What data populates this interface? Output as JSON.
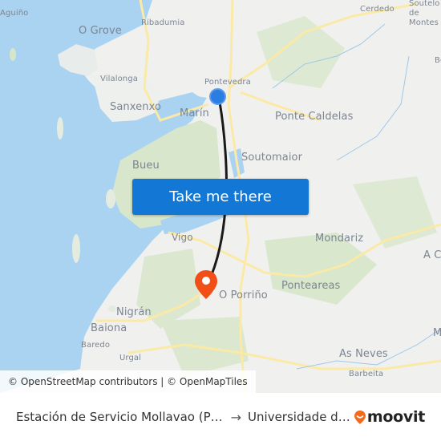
{
  "map": {
    "places": [
      {
        "name": "Aguiño",
        "size": "sm"
      },
      {
        "name": "O Grove",
        "size": "lg"
      },
      {
        "name": "Ribadumia",
        "size": "sm"
      },
      {
        "name": "Cerdedo",
        "size": "sm"
      },
      {
        "name": "Soutelo de Montes",
        "size": "sm"
      },
      {
        "name": "Pontevedra",
        "size": "sm"
      },
      {
        "name": "Vilalonga",
        "size": "sm"
      },
      {
        "name": "Sanxenxo",
        "size": "lg"
      },
      {
        "name": "Marín",
        "size": "lg"
      },
      {
        "name": "Ponte Caldelas",
        "size": "lg"
      },
      {
        "name": "Soutomaior",
        "size": "lg"
      },
      {
        "name": "Bueu",
        "size": "lg"
      },
      {
        "name": "Vigo",
        "size": "md"
      },
      {
        "name": "Mondariz",
        "size": "lg"
      },
      {
        "name": "A Ca",
        "size": "lg"
      },
      {
        "name": "O Porriño",
        "size": "lg"
      },
      {
        "name": "Ponteareas",
        "size": "lg"
      },
      {
        "name": "Nigrán",
        "size": "lg"
      },
      {
        "name": "Baiona",
        "size": "lg"
      },
      {
        "name": "Baredo",
        "size": "sm"
      },
      {
        "name": "Urgal",
        "size": "sm"
      },
      {
        "name": "As Neves",
        "size": "lg"
      },
      {
        "name": "Barbeita",
        "size": "sm"
      },
      {
        "name": "Be",
        "size": "sm"
      },
      {
        "name": "M",
        "size": "lg"
      }
    ],
    "cta_label": "Take me there",
    "attribution": "© OpenStreetMap contributors | © OpenMapTiles",
    "colors": {
      "water": "#aad3f2",
      "land": "#f0f0ef",
      "green": "#d6e6c8",
      "road": "#fbe9a6",
      "route": "#1a1a1a",
      "origin": "#2a7de1",
      "destination": "#f24e17",
      "cta": "#1377d5"
    }
  },
  "footer": {
    "from": "Estación de Servicio Mollavao (P…",
    "arrow": "→",
    "to": "Universidade d…",
    "brand": "moovit"
  }
}
